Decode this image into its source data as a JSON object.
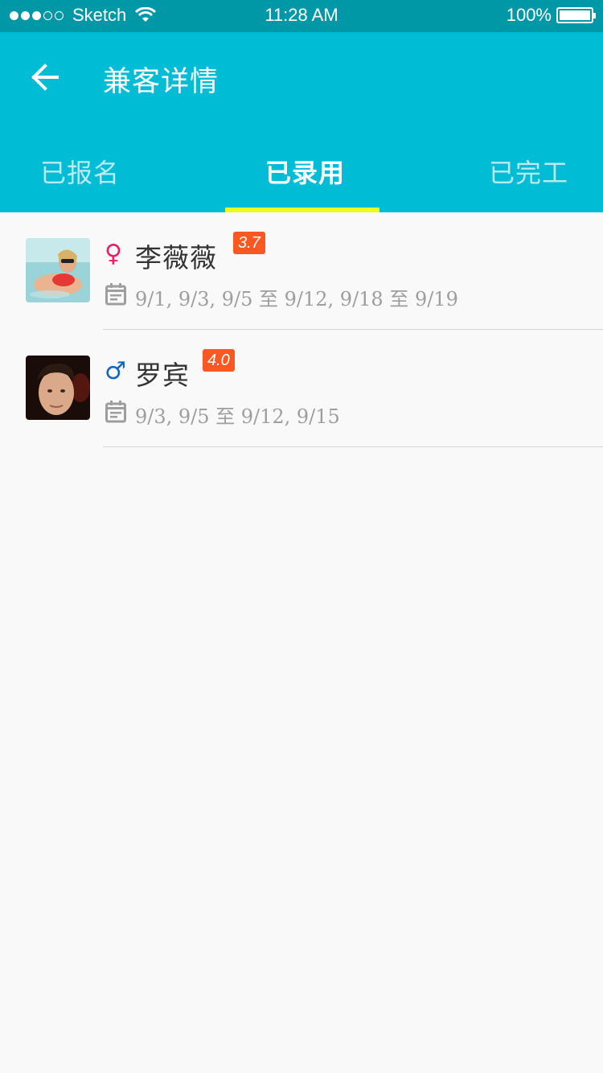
{
  "status_bar": {
    "carrier": "Sketch",
    "time": "11:28 AM",
    "battery": "100%",
    "signal_bars": 3
  },
  "app_bar": {
    "title": "兼客详情",
    "back_icon": "arrow-left-icon"
  },
  "tabs": [
    {
      "label": "已报名",
      "active": false
    },
    {
      "label": "已录用",
      "active": true
    },
    {
      "label": "已完工",
      "active": false
    }
  ],
  "colors": {
    "status_bar": "#0097a7",
    "app_bar": "#00bcd4",
    "tab_indicator": "#e6ff1f",
    "rating_badge": "#ff5722",
    "female": "#e91e63",
    "male": "#1565c0"
  },
  "workers": [
    {
      "name": "李薇薇",
      "gender_symbol": "♀",
      "rating": "3.7",
      "dates": "9/1, 9/3, 9/5 至 9/12, 9/18 至 9/19",
      "avatar": "female-avatar-photo"
    },
    {
      "name": "罗宾",
      "gender_symbol": "♂",
      "rating": "4.0",
      "dates": "9/3, 9/5 至 9/12, 9/15",
      "avatar": "male-avatar-photo"
    }
  ]
}
